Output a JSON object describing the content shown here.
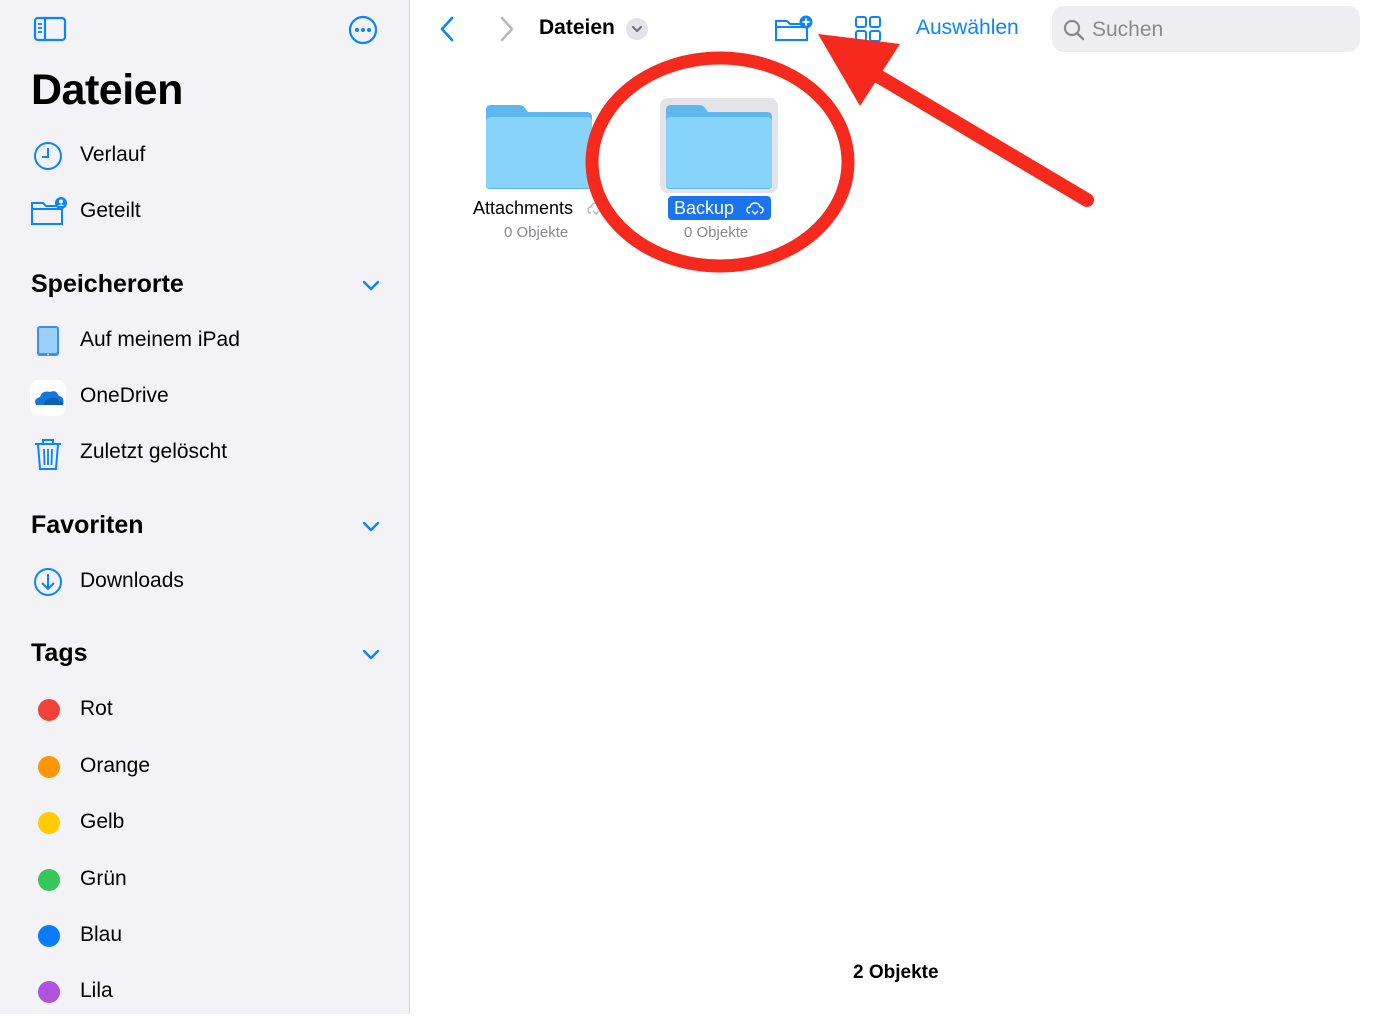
{
  "sidebar": {
    "title": "Dateien",
    "items_top": [
      {
        "label": "Verlauf",
        "icon": "clock-icon"
      },
      {
        "label": "Geteilt",
        "icon": "shared-folder-icon"
      }
    ],
    "sections": {
      "locations": {
        "label": "Speicherorte",
        "items": [
          {
            "label": "Auf meinem iPad",
            "icon": "ipad-icon"
          },
          {
            "label": "OneDrive",
            "icon": "onedrive-icon"
          },
          {
            "label": "Zuletzt gelöscht",
            "icon": "trash-icon"
          }
        ]
      },
      "favorites": {
        "label": "Favoriten",
        "items": [
          {
            "label": "Downloads",
            "icon": "download-icon"
          }
        ]
      },
      "tags": {
        "label": "Tags",
        "items": [
          {
            "label": "Rot",
            "color": "#f2413b"
          },
          {
            "label": "Orange",
            "color": "#ff9500"
          },
          {
            "label": "Gelb",
            "color": "#ffcc00"
          },
          {
            "label": "Grün",
            "color": "#34c759"
          },
          {
            "label": "Blau",
            "color": "#0a7aff"
          },
          {
            "label": "Lila",
            "color": "#af52de"
          }
        ]
      }
    }
  },
  "toolbar": {
    "breadcrumb": "Dateien",
    "select_label": "Auswählen",
    "search_placeholder": "Suchen"
  },
  "folders": [
    {
      "name": "Attachments",
      "count": "0 Objekte",
      "selected": false
    },
    {
      "name": "Backup",
      "count": "0 Objekte",
      "selected": true
    }
  ],
  "footer": {
    "count": "2 Objekte"
  },
  "colors": {
    "accent": "#0a84ff",
    "annotation": "#f52a1d",
    "folder": "#7fcef7"
  }
}
